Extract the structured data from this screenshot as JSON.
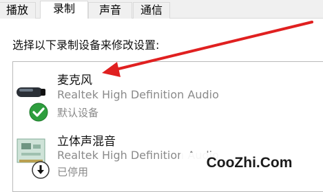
{
  "tabs": [
    {
      "label": "播放",
      "active": false
    },
    {
      "label": "录制",
      "active": true
    },
    {
      "label": "声音",
      "active": false
    },
    {
      "label": "通信",
      "active": false
    }
  ],
  "instruction": "选择以下录制设备来修改设置:",
  "devices": [
    {
      "name": "麦克风",
      "driver": "Realtek High Definition Audio",
      "status": "默认设备",
      "icon": "microphone-icon",
      "badge": "default-check-icon"
    },
    {
      "name": "立体声混音",
      "driver": "Realtek High Definition Audio",
      "status": "已停用",
      "icon": "sound-card-icon",
      "badge": "disabled-arrow-icon"
    }
  ],
  "watermark": "CooZhi.Com",
  "colors": {
    "annotation_arrow": "#e02020",
    "check_badge": "#2e9e3e",
    "secondary_text": "#8a8a8a"
  }
}
